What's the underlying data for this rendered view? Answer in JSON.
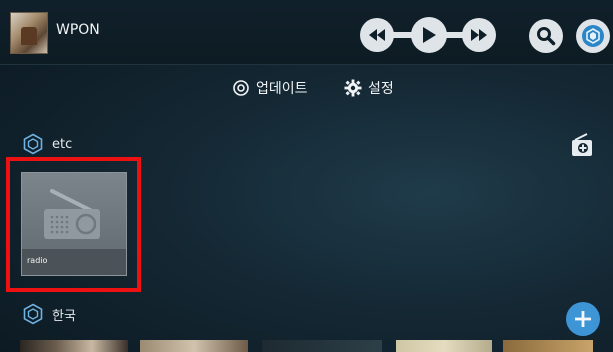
{
  "app": {
    "title": "WPON"
  },
  "menu": {
    "update_label": "업데이트",
    "settings_label": "설정"
  },
  "sections": [
    {
      "label": "etc",
      "items": [
        {
          "label": "radio"
        }
      ]
    },
    {
      "label": "한국"
    }
  ],
  "colors": {
    "accent_blue": "#3d95d6",
    "highlight_red": "#ee1111"
  },
  "icons": {
    "transport": [
      "rewind-icon",
      "play-icon",
      "fast-forward-icon"
    ],
    "search": "search-icon",
    "hub": "hub-icon",
    "add_station": "add-station-icon",
    "fab": "plus-icon"
  }
}
